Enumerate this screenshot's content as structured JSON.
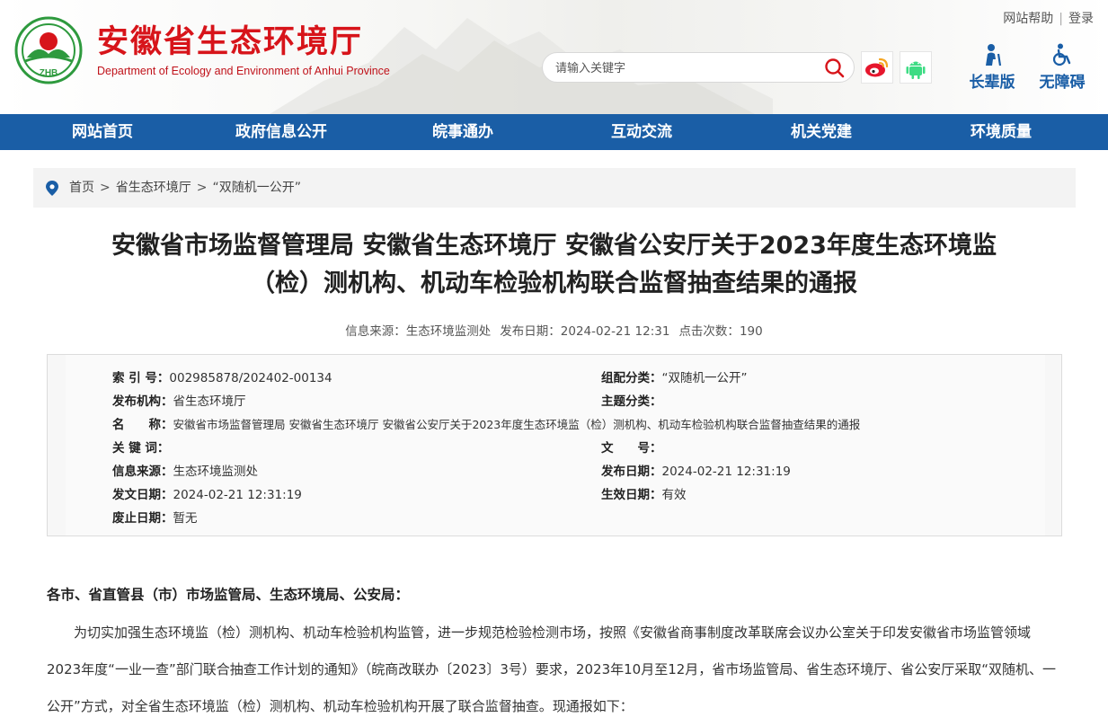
{
  "header": {
    "site_title": "安徽省生态环境厅",
    "site_subtitle": "Department of Ecology and Environment of Anhui Province",
    "logo_text": "ZHB",
    "help_link": "网站帮助",
    "login_link": "登录",
    "search_placeholder": "请输入关键字",
    "elder_mode": "长辈版",
    "accessibility": "无障碍"
  },
  "nav": {
    "items": [
      "网站首页",
      "政府信息公开",
      "皖事通办",
      "互动交流",
      "机关党建",
      "环境质量"
    ]
  },
  "breadcrumb": {
    "items": [
      "首页",
      "省生态环境厅",
      "“双随机一公开”"
    ],
    "separator": ">"
  },
  "article": {
    "title_line1": "安徽省市场监督管理局 安徽省生态环境厅 安徽省公安厅关于2023年度生态环境监",
    "title_line2": "（检）测机构、机动车检验机构联合监督抽查结果的通报",
    "meta_source_label": "信息来源：",
    "meta_source": "生态环境监测处",
    "meta_date_label": "发布日期：",
    "meta_date": "2024-02-21 12:31",
    "meta_views_label": "点击次数：",
    "meta_views": "190"
  },
  "info": {
    "index_label": "索 引 号：",
    "index_value": "002985878/202402-00134",
    "category_label": "组配分类：",
    "category_value": "“双随机一公开”",
    "publisher_label": "发布机构：",
    "publisher_value": "省生态环境厅",
    "topic_label": "主题分类：",
    "topic_value": "",
    "name_label": "名　　称：",
    "name_value": "安徽省市场监督管理局 安徽省生态环境厅 安徽省公安厅关于2023年度生态环境监（检）测机构、机动车检验机构联合监督抽查结果的通报",
    "keywords_label": "关 键 词：",
    "keywords_value": "",
    "docno_label": "文　　号：",
    "docno_value": "",
    "source_label": "信息来源：",
    "source_value": "生态环境监测处",
    "pubdate_label": "发布日期：",
    "pubdate_value": "2024-02-21 12:31:19",
    "issuedate_label": "发文日期：",
    "issuedate_value": "2024-02-21 12:31:19",
    "effective_label": "生效日期：",
    "effective_value": "有效",
    "abolish_label": "废止日期：",
    "abolish_value": "暂无"
  },
  "body": {
    "salutation": "各市、省直管县（市）市场监管局、生态环境局、公安局：",
    "paragraph1": "为切实加强生态环境监（检）测机构、机动车检验机构监管，进一步规范检验检测市场，按照《安徽省商事制度改革联席会议办公室关于印发安徽省市场监管领域2023年度“一业一查”部门联合抽查工作计划的通知》（皖商改联办〔2023〕3号）要求，2023年10月至12月，省市场监管局、省生态环境厅、省公安厅采取“双随机、一公开”方式，对全省生态环境监（检）测机构、机动车检验机构开展了联合监督抽查。现通报如下："
  },
  "colors": {
    "brand_red": "#d7141a",
    "nav_blue": "#1a5ea6",
    "logo_green": "#2e9a3e"
  }
}
